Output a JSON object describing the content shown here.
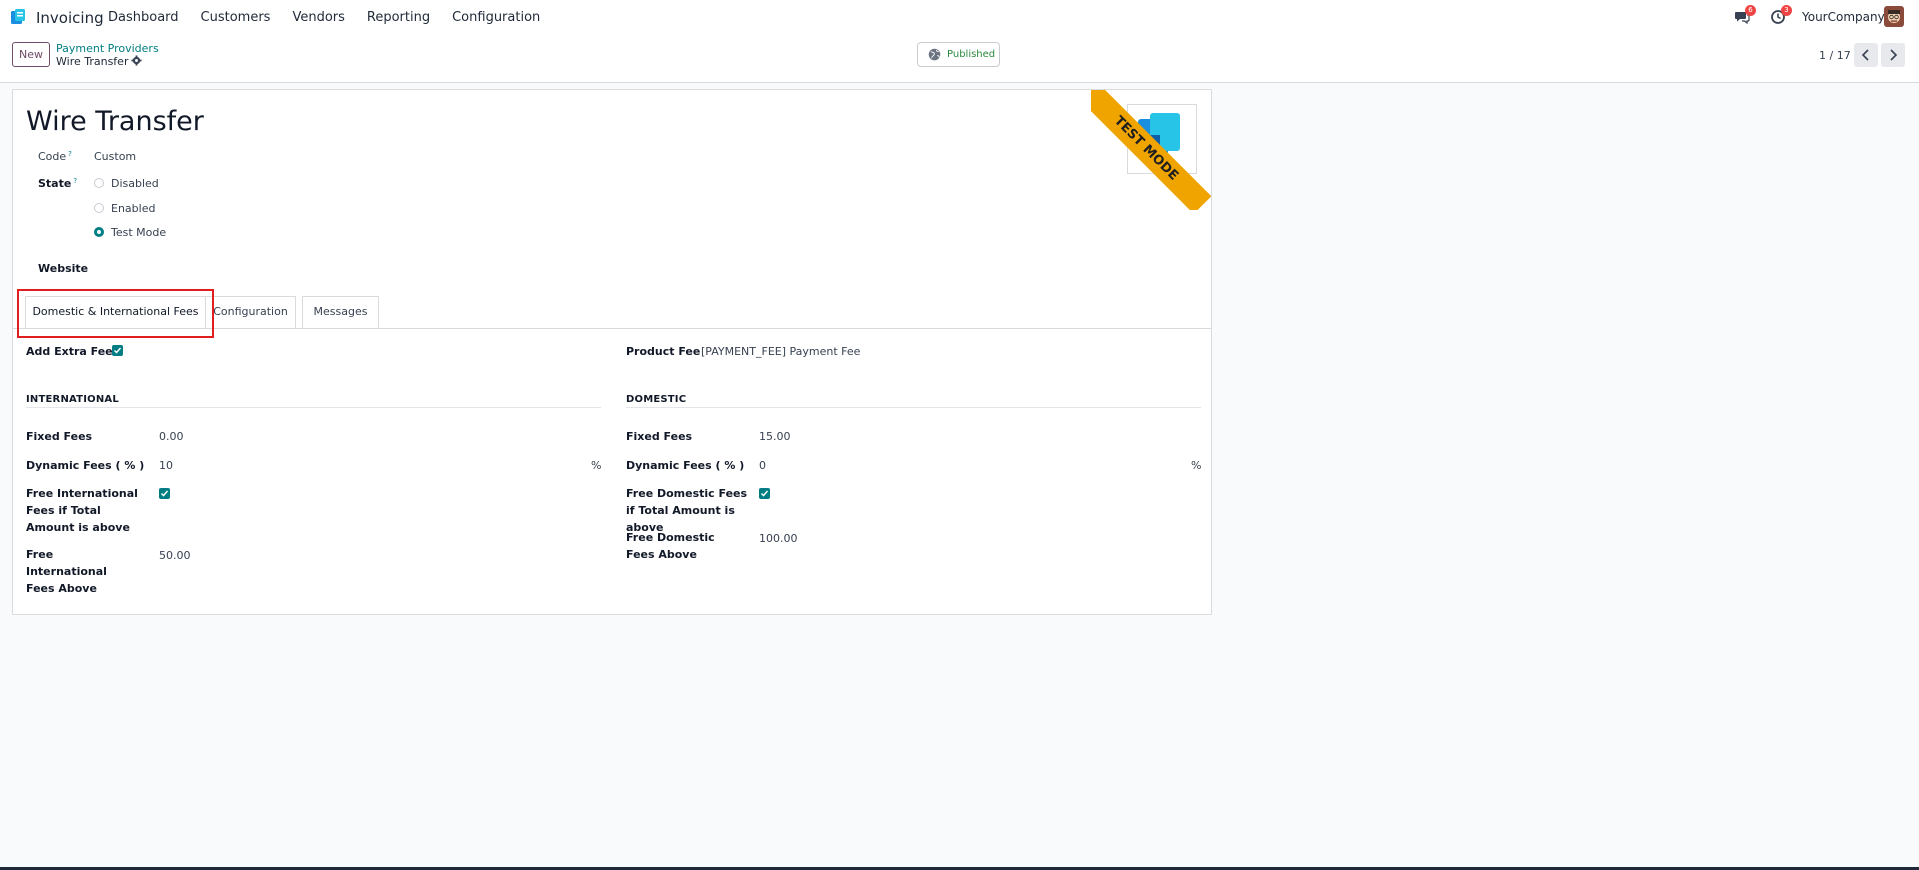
{
  "navbar": {
    "app_name": "Invoicing",
    "menu": [
      "Dashboard",
      "Customers",
      "Vendors",
      "Reporting",
      "Configuration"
    ],
    "messages_count": "6",
    "activities_count": "3",
    "company": "YourCompany",
    "icons": [
      "app-logo-icon",
      "chat-icon",
      "clock-icon",
      "avatar"
    ]
  },
  "control": {
    "new_label": "New",
    "breadcrumb_parent": "Payment Providers",
    "breadcrumb_current": "Wire Transfer",
    "published_label": "Published",
    "pager": "1 / 17"
  },
  "form": {
    "title": "Wire Transfer",
    "ribbon": "TEST MODE",
    "code_label": "Code",
    "code_help": "?",
    "code_value": "Custom",
    "state_label": "State",
    "state_help": "?",
    "state_options": [
      "Disabled",
      "Enabled",
      "Test Mode"
    ],
    "state_selected": "Test Mode",
    "website_label": "Website"
  },
  "tabs": [
    "Domestic & International Fees",
    "Configuration",
    "Messages"
  ],
  "fees": {
    "add_extra_fee_label": "Add Extra Fee",
    "add_extra_fee": true,
    "product_fee_label": "Product Fee",
    "product_fee_value": "[PAYMENT_FEE] Payment Fee",
    "international": {
      "title": "INTERNATIONAL",
      "fixed_label": "Fixed Fees",
      "fixed_value": "0.00",
      "dynamic_label": "Dynamic Fees ( % )",
      "dynamic_value": "10",
      "dynamic_unit": "%",
      "free_label": "Free International Fees if Total Amount is above",
      "free_checked": true,
      "free_above_label": "Free International Fees Above",
      "free_above_value": "50.00"
    },
    "domestic": {
      "title": "DOMESTIC",
      "fixed_label": "Fixed Fees",
      "fixed_value": "15.00",
      "dynamic_label": "Dynamic Fees ( % )",
      "dynamic_value": "0",
      "dynamic_unit": "%",
      "free_label": "Free Domestic Fees if Total Amount is above",
      "free_checked": true,
      "free_above_label": "Free Domestic Fees Above",
      "free_above_value": "100.00"
    }
  },
  "colors": {
    "brand": "#714b67",
    "accent": "#017e84",
    "ribbon": "#f0a400",
    "highlight": "#e11d1d",
    "published": "#2b8a3e"
  }
}
